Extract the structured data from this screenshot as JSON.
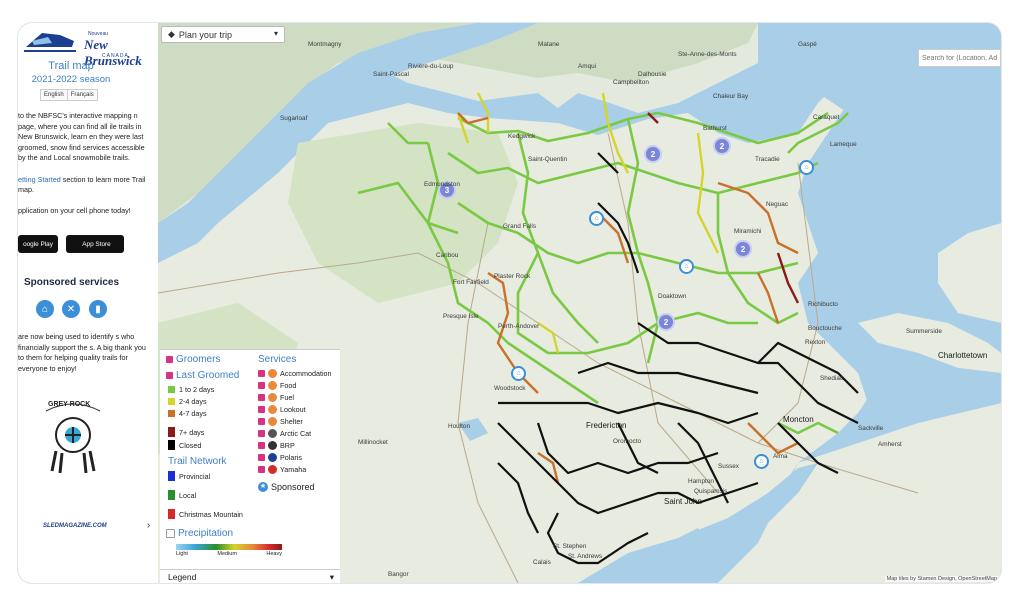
{
  "header": {
    "logo_org": "New Brunswick",
    "logo_sub": "Nouveau",
    "logo_country": "CANADA",
    "title": "Trail map",
    "season": "2021-2022 season",
    "lang_en": "English",
    "lang_fr": "Français"
  },
  "intro": {
    "p1": "to the NBFSC's interactive mapping n page, where you can find all ile trails in New Brunswick, learn en they were last groomed, snow find services accessible by the and Local snowmobile trails.",
    "link": "etting Started",
    "p2": " section to learn more Trail map.",
    "p3": "pplication on your cell phone today!",
    "google_play": "oogle Play",
    "app_store": "App Store"
  },
  "sponsored": {
    "heading": "Sponsored services",
    "icons": [
      "shelter-icon",
      "food-icon",
      "fuel-icon"
    ],
    "thanks": "are now being used to identify s who financially support the s. A big thank you to them for helping quality trails for everyone to enjoy!",
    "partner": "GREY ROCK",
    "slednow": "SLEDMAGAZINE.COM"
  },
  "toolbar": {
    "plan_trip": "Plan your trip",
    "search_placeholder": "Search for (Location, Add"
  },
  "legend": {
    "groomers": "Groomers",
    "last_groomed": "Last Groomed",
    "groom_levels": [
      {
        "label": "1 to 2 days",
        "color": "#7ac943"
      },
      {
        "label": "2-4 days",
        "color": "#d4d42a"
      },
      {
        "label": "4-7 days",
        "color": "#c9702a"
      },
      {
        "label": "7+ days",
        "color": "#8b1a1a"
      },
      {
        "label": "Closed",
        "color": "#000000"
      }
    ],
    "trail_network": "Trail Network",
    "networks": [
      {
        "label": "Provincial",
        "color": "#1a2fd6"
      },
      {
        "label": "Local",
        "color": "#2a8f2a"
      },
      {
        "label": "Christmas Mountain",
        "color": "#d62a2a"
      }
    ],
    "services": "Services",
    "service_items": [
      "Accommodation",
      "Food",
      "Fuel",
      "Lookout",
      "Shelter",
      "Arctic Cat",
      "BRP",
      "Polaris",
      "Yamaha"
    ],
    "sponsored": "Sponsored",
    "precipitation": "Precipitation",
    "precip_scale": [
      "Light",
      "Medium",
      "Heavy"
    ],
    "footer": "Legend"
  },
  "map": {
    "clusters": [
      "2",
      "2",
      "3",
      "2",
      "2"
    ],
    "places": [
      "Campbellton",
      "Dalhousie",
      "Bathurst",
      "Caraquet",
      "Tracadie",
      "Miramichi",
      "Edmundston",
      "Saint-Quentin",
      "Grand Falls",
      "Perth-Andover",
      "Woodstock",
      "Fredericton",
      "Moncton",
      "Sussex",
      "Saint John",
      "Shediac",
      "Bouctouche",
      "Richibucto",
      "Summerside",
      "Charlottetown",
      "Caribou",
      "Presque Isle",
      "Millinocket",
      "Houlton",
      "Hampton",
      "Quispamsis",
      "St. Stephen",
      "Bangor",
      "Amherst",
      "Sackville",
      "Montmagny",
      "Rivière-du-Loup",
      "Matane",
      "Amqui",
      "Gaspé",
      "Chaleur Bay",
      "Fort Fairfield",
      "Saint-Pascal",
      "Ste-Anne-des-Monts",
      "Lameque",
      "Neguac",
      "Doaktown",
      "Oromocto",
      "St. Andrews",
      "Calais",
      "Alma",
      "Sugarloaf",
      "Rexton",
      "Kedgwick",
      "Plaster Rock"
    ],
    "attribution": "Map tiles by Stamen Design, OpenStreetMap"
  }
}
